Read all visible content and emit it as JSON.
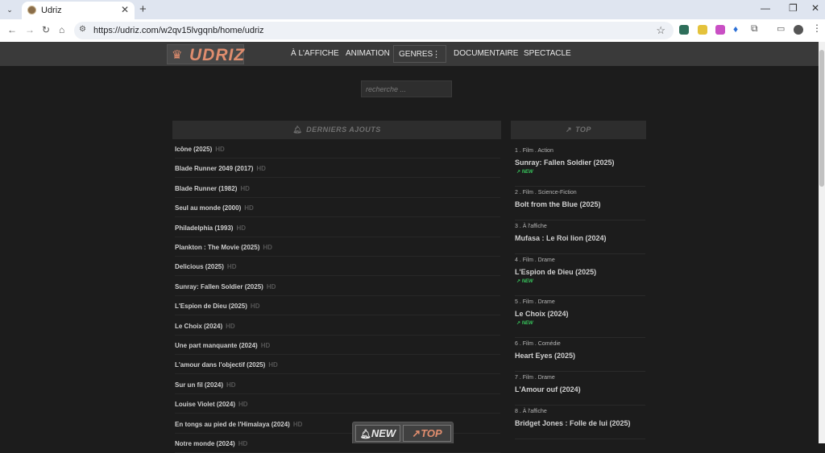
{
  "browser": {
    "tab_title": "Udriz",
    "url": "https://udriz.com/w2qv15lvgqnb/home/udriz"
  },
  "site": {
    "logo_text": "UDRIZ",
    "brand_color": "#e08d6e",
    "menu": {
      "a_laffiche": "À L'AFFICHE",
      "animation": "ANIMATION",
      "genres": "GENRES",
      "documentaire": "DOCUMENTAIRE",
      "spectacle": "SPECTACLE"
    },
    "search_placeholder": "recherche ..."
  },
  "latest": {
    "title": "DERNIERS AJOUTS",
    "items": [
      {
        "title": "Icône (2025)",
        "quality": "HD"
      },
      {
        "title": "Blade Runner 2049 (2017)",
        "quality": "HD"
      },
      {
        "title": "Blade Runner (1982)",
        "quality": "HD"
      },
      {
        "title": "Seul au monde (2000)",
        "quality": "HD"
      },
      {
        "title": "Philadelphia (1993)",
        "quality": "HD"
      },
      {
        "title": "Plankton : The Movie (2025)",
        "quality": "HD"
      },
      {
        "title": "Delicious (2025)",
        "quality": "HD"
      },
      {
        "title": "Sunray: Fallen Soldier (2025)",
        "quality": "HD"
      },
      {
        "title": "L'Espion de Dieu (2025)",
        "quality": "HD"
      },
      {
        "title": "Le Choix (2024)",
        "quality": "HD"
      },
      {
        "title": "Une part manquante (2024)",
        "quality": "HD"
      },
      {
        "title": "L'amour dans l'objectif (2025)",
        "quality": "HD"
      },
      {
        "title": "Sur un fil (2024)",
        "quality": "HD"
      },
      {
        "title": "Louise Violet (2024)",
        "quality": "HD"
      },
      {
        "title": "En tongs au pied de l'Himalaya (2024)",
        "quality": "HD"
      },
      {
        "title": "Notre monde (2024)",
        "quality": "HD"
      }
    ]
  },
  "top": {
    "title": "TOP",
    "new_label": "NEW",
    "new_color": "#37c35b",
    "items": [
      {
        "meta": "1 . Film . Action",
        "title": "Sunray: Fallen Soldier (2025)",
        "is_new": true
      },
      {
        "meta": "2 . Film . Science-Fiction",
        "title": "Bolt from the Blue (2025)",
        "is_new": false
      },
      {
        "meta": "3 . À l'affiche",
        "title": "Mufasa : Le Roi lion (2024)",
        "is_new": false
      },
      {
        "meta": "4 . Film . Drame",
        "title": "L'Espion de Dieu (2025)",
        "is_new": true
      },
      {
        "meta": "5 . Film . Drame",
        "title": "Le Choix (2024)",
        "is_new": true
      },
      {
        "meta": "6 . Film . Comédie",
        "title": "Heart Eyes (2025)",
        "is_new": false
      },
      {
        "meta": "7 . Film . Drame",
        "title": "L'Amour ouf (2024)",
        "is_new": false
      },
      {
        "meta": "8 . À l'affiche",
        "title": "Bridget Jones : Folle de lui (2025)",
        "is_new": false
      }
    ]
  },
  "floating": {
    "new_label": "NEW",
    "top_label": "TOP"
  }
}
